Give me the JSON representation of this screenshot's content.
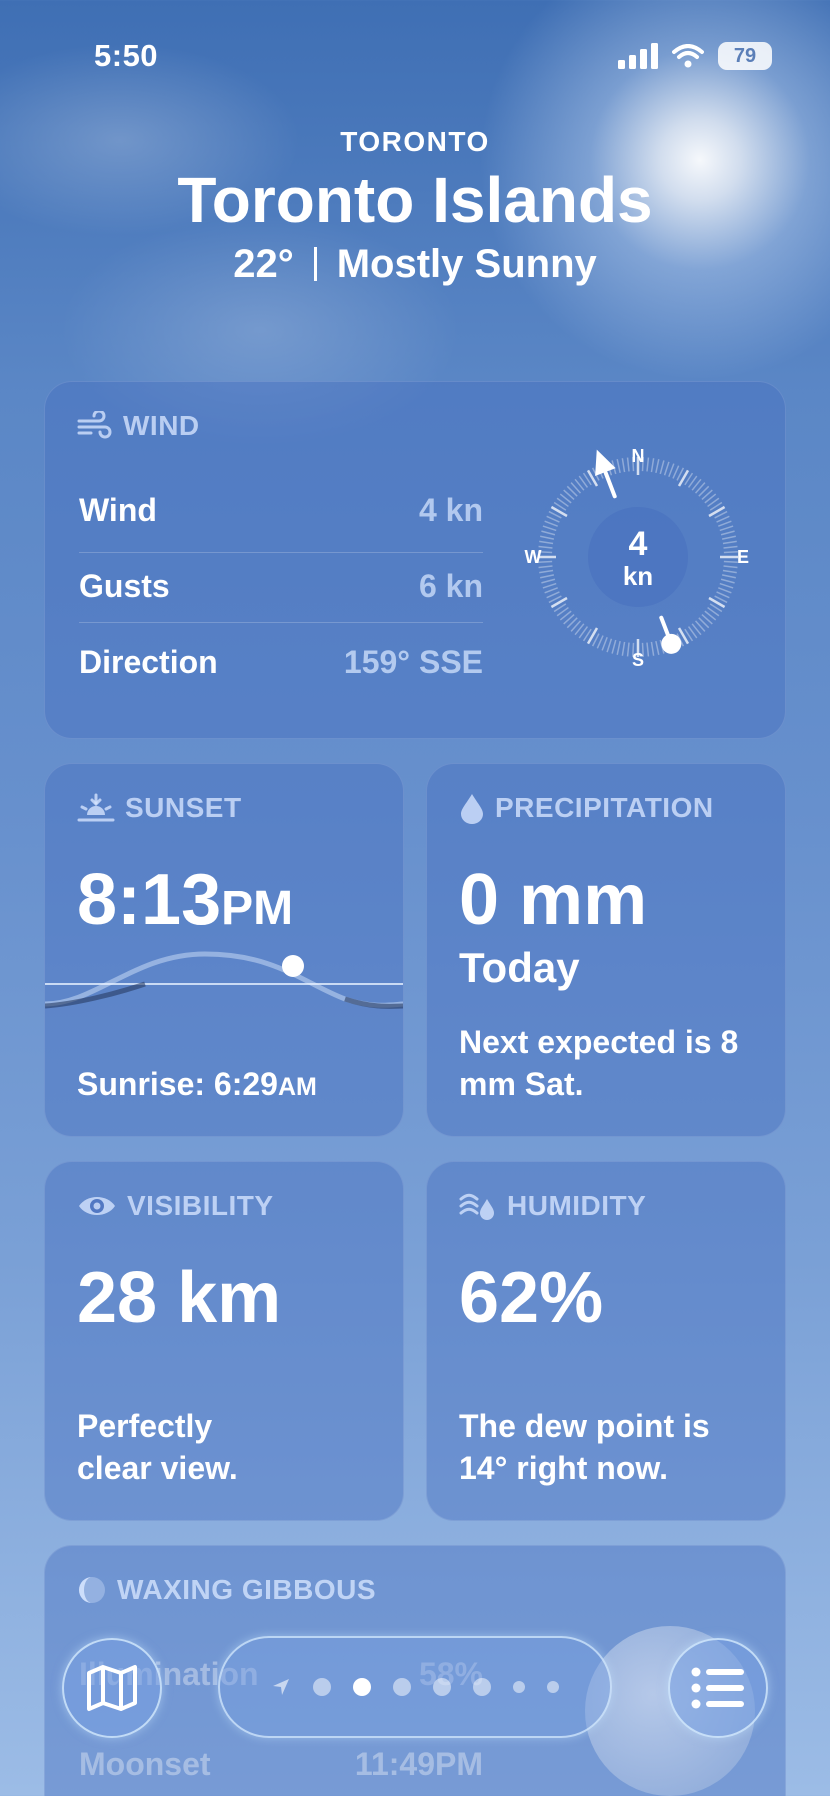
{
  "status_bar": {
    "time": "5:50",
    "battery": "79"
  },
  "location": {
    "region": "TORONTO",
    "name": "Toronto Islands",
    "temperature": "22°",
    "condition": "Mostly Sunny"
  },
  "wind": {
    "title": "WIND",
    "rows": [
      {
        "label": "Wind",
        "value": "4 kn"
      },
      {
        "label": "Gusts",
        "value": "6 kn"
      },
      {
        "label": "Direction",
        "value": "159° SSE"
      }
    ],
    "compass": {
      "speed": "4",
      "unit": "kn",
      "n": "N",
      "e": "E",
      "s": "S",
      "w": "W",
      "direction_degrees": 159
    }
  },
  "sunset": {
    "title": "SUNSET",
    "time": "8:13",
    "ampm": "PM",
    "sunrise_label": "Sunrise: 6:29",
    "sunrise_ampm": "AM"
  },
  "precipitation": {
    "title": "PRECIPITATION",
    "amount": "0 mm",
    "period": "Today",
    "note": "Next expected is 8 mm Sat."
  },
  "visibility": {
    "title": "VISIBILITY",
    "value": "28 km",
    "note": "Perfectly clear view."
  },
  "humidity": {
    "title": "HUMIDITY",
    "value": "62%",
    "note": "The dew point is 14° right now."
  },
  "moon": {
    "title": "WAXING GIBBOUS",
    "rows": [
      {
        "label": "Illumination",
        "value": "58%"
      },
      {
        "label": "Moonset",
        "value": "11:49PM"
      }
    ]
  },
  "pager": {
    "pages": 7,
    "active_index": 1
  },
  "icons": {
    "map": "map-icon",
    "list": "list-icon",
    "location": "location-arrow-icon"
  }
}
